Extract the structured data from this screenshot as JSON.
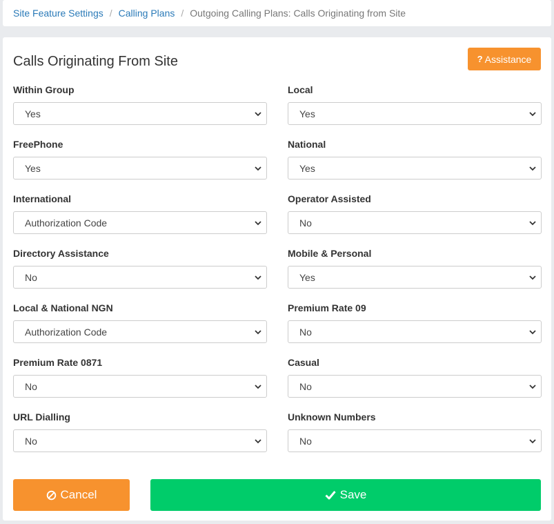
{
  "breadcrumb": {
    "items": [
      "Site Feature Settings",
      "Calling Plans"
    ],
    "current": "Outgoing Calling Plans: Calls Originating from Site"
  },
  "panel": {
    "title": "Calls Originating From Site",
    "assistance_label": "Assistance"
  },
  "fields": [
    {
      "label": "Within Group",
      "value": "Yes"
    },
    {
      "label": "Local",
      "value": "Yes"
    },
    {
      "label": "FreePhone",
      "value": "Yes"
    },
    {
      "label": "National",
      "value": "Yes"
    },
    {
      "label": "International",
      "value": "Authorization Code"
    },
    {
      "label": "Operator Assisted",
      "value": "No"
    },
    {
      "label": "Directory Assistance",
      "value": "No"
    },
    {
      "label": "Mobile & Personal",
      "value": "Yes"
    },
    {
      "label": "Local & National NGN",
      "value": "Authorization Code"
    },
    {
      "label": "Premium Rate 09",
      "value": "No"
    },
    {
      "label": "Premium Rate 0871",
      "value": "No"
    },
    {
      "label": "Casual",
      "value": "No"
    },
    {
      "label": "URL Dialling",
      "value": "No"
    },
    {
      "label": "Unknown Numbers",
      "value": "No"
    }
  ],
  "actions": {
    "cancel_label": "Cancel",
    "save_label": "Save"
  },
  "colors": {
    "accent_orange": "#f7922e",
    "save_green": "#00cc6a",
    "link_blue": "#2a7ab8"
  },
  "icons": {
    "assistance": "question-icon",
    "cancel": "ban-icon",
    "save": "check-icon",
    "select": "chevron-down-icon"
  }
}
